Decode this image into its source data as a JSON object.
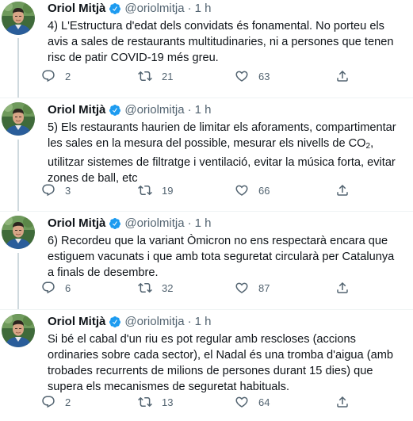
{
  "tweets": [
    {
      "name": "Oriol Mitjà",
      "handle": "@oriolmitja",
      "dot": "·",
      "time": "1 h",
      "text": "4) L'Estructura d'edat dels convidats és fonamental. No porteu els avis a sales de restaurants multitudinaries, ni a persones que tenen risc de patir COVID-19 més greu.",
      "replies": "2",
      "retweets": "21",
      "likes": "63"
    },
    {
      "name": "Oriol Mitjà",
      "handle": "@oriolmitja",
      "dot": "·",
      "time": "1 h",
      "text_a": "5) Els restaurants haurien de limitar els aforaments, compartimentar les sales en la mesura del possible, mesurar els nivells de CO",
      "text_sub": "2",
      "text_b": ", utilitzar sistemes de filtratge i ventilació, evitar la música forta, evitar zones de ball, etc",
      "replies": "3",
      "retweets": "19",
      "likes": "66"
    },
    {
      "name": "Oriol Mitjà",
      "handle": "@oriolmitja",
      "dot": "·",
      "time": "1 h",
      "text": "6) Recordeu que la variant Òmicron no ens respectarà encara que estiguem vacunats i que amb tota seguretat circularà per Catalunya a finals de desembre.",
      "replies": "6",
      "retweets": "32",
      "likes": "87"
    },
    {
      "name": "Oriol Mitjà",
      "handle": "@oriolmitja",
      "dot": "·",
      "time": "1 h",
      "text": "Si bé el cabal d'un riu es pot regular amb rescloses (accions ordinaries sobre cada sector), el Nadal és una tromba d'aigua (amb trobades recurrents de milions de persones durant 15 dies) que supera els mecanismes de seguretat habituals.",
      "replies": "2",
      "retweets": "13",
      "likes": "64"
    }
  ],
  "icons": {
    "reply": "reply-icon",
    "retweet": "retweet-icon",
    "like": "like-icon",
    "share": "share-icon",
    "verified": "verified-badge-icon"
  },
  "colors": {
    "text": "#0f1419",
    "secondary": "#536471",
    "verified": "#1d9bf0",
    "thread_line": "#cfd9de",
    "divider": "#eff3f4"
  }
}
